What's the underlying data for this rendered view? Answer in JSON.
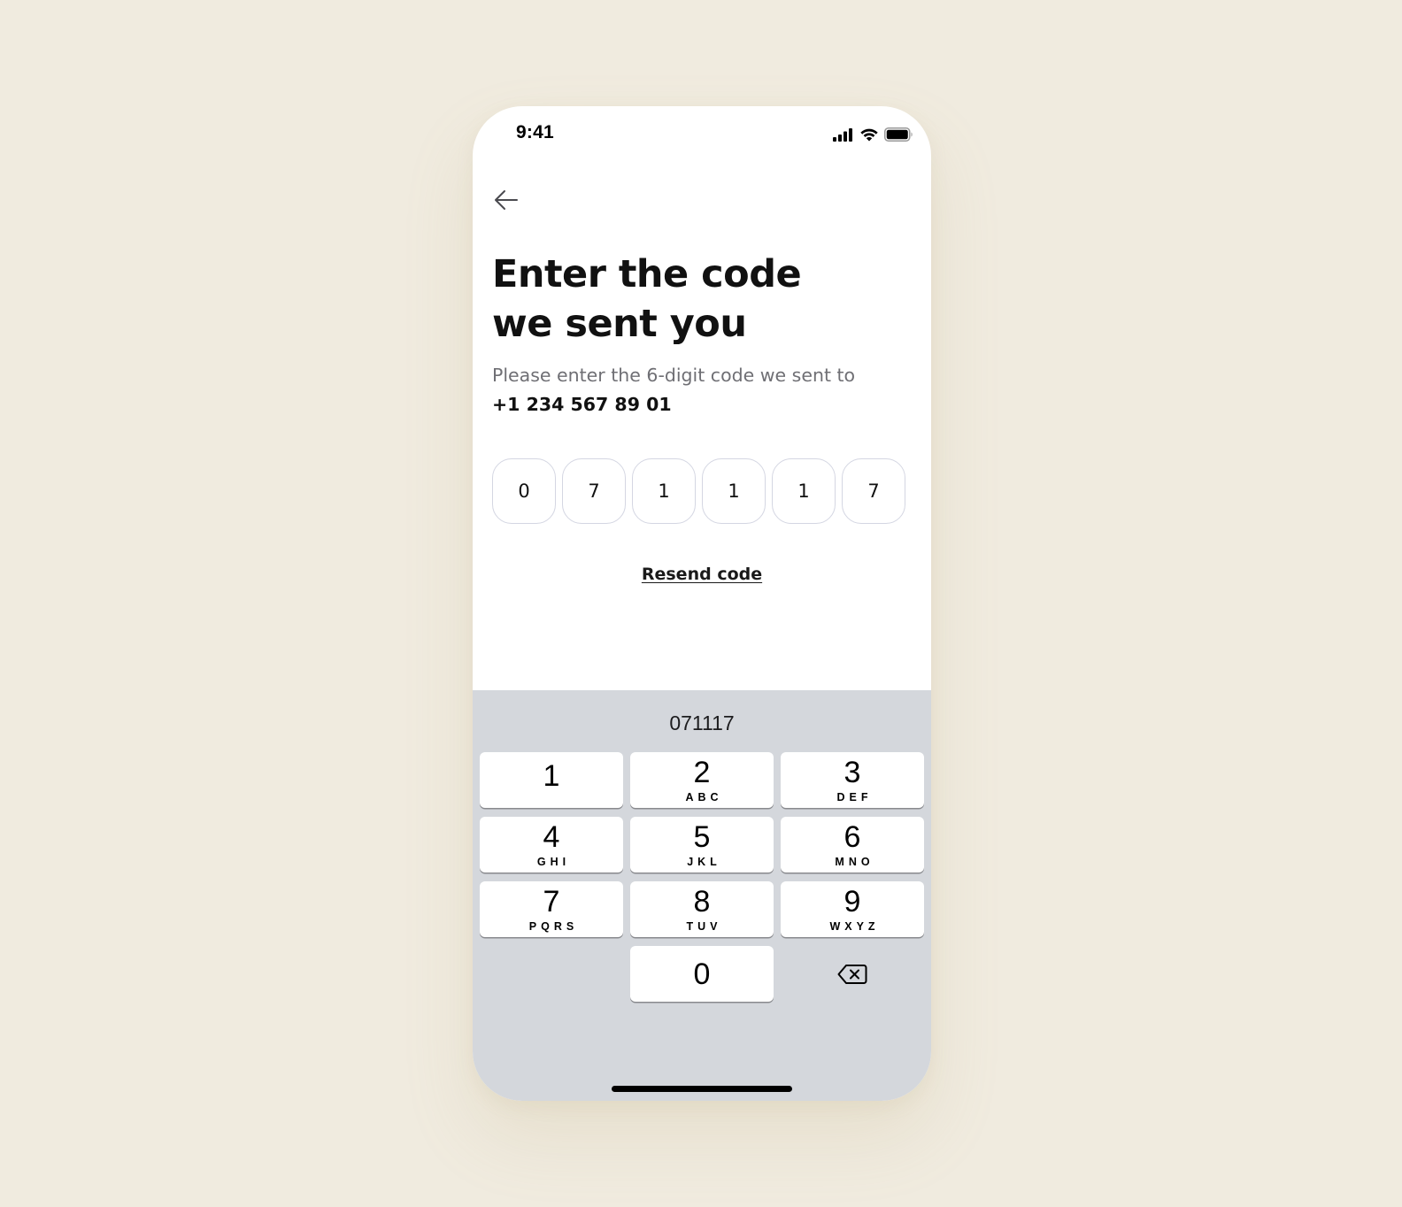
{
  "status_bar": {
    "time": "9:41",
    "icons": [
      "signal-icon",
      "wifi-icon",
      "battery-icon"
    ]
  },
  "header": {
    "back_icon": "arrow-left-icon"
  },
  "main": {
    "title_line1": "Enter the code",
    "title_line2": "we sent you",
    "subtitle": "Please enter the 6-digit code we sent to",
    "phone_number": "+1 234 567 89 01",
    "code_digits": [
      "0",
      "7",
      "1",
      "1",
      "1",
      "7"
    ],
    "resend_label": "Resend code"
  },
  "keyboard": {
    "suggestion": "071117",
    "keys": [
      {
        "digit": "1",
        "letters": ""
      },
      {
        "digit": "2",
        "letters": "ABC"
      },
      {
        "digit": "3",
        "letters": "DEF"
      },
      {
        "digit": "4",
        "letters": "GHI"
      },
      {
        "digit": "5",
        "letters": "JKL"
      },
      {
        "digit": "6",
        "letters": "MNO"
      },
      {
        "digit": "7",
        "letters": "PQRS"
      },
      {
        "digit": "8",
        "letters": "TUV"
      },
      {
        "digit": "9",
        "letters": "WXYZ"
      },
      {
        "digit": "0",
        "letters": ""
      }
    ],
    "delete_icon": "backspace-icon"
  },
  "colors": {
    "background": "#f0ebdf",
    "keyboard_bg": "#d4d7dc",
    "otp_border": "#d4d6e2",
    "subtitle_text": "#6f6f74"
  }
}
